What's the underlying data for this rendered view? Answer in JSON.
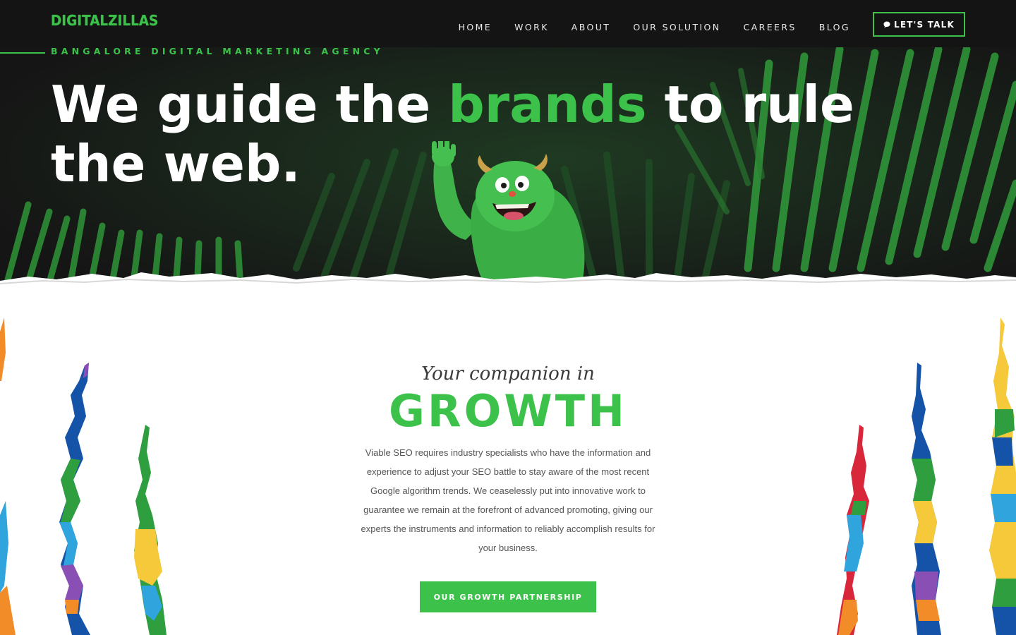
{
  "brand": {
    "logo_text": "DIGITALZILLAS",
    "accent_color": "#3cc24a",
    "dark_color": "#161616"
  },
  "nav": {
    "items": [
      {
        "label": "HOME"
      },
      {
        "label": "WORK"
      },
      {
        "label": "ABOUT"
      },
      {
        "label": "OUR SOLUTION"
      },
      {
        "label": "CAREERS"
      },
      {
        "label": "BLOG"
      }
    ],
    "cta_label": "LET'S TALK",
    "cta_icon": "chat-bubble-icon"
  },
  "hero": {
    "tagline": "BANGALORE DIGITAL MARKETING AGENCY",
    "headline_part1": "We guide the ",
    "headline_accent": "brands",
    "headline_part2": " to rule the web.",
    "mascot": "green-monster-mascot-waving",
    "background": "jungle-palm-leaves"
  },
  "growth": {
    "intro": "Your companion in",
    "title": "GROWTH",
    "body": "Viable SEO requires industry specialists who have the information and experience to adjust your SEO battle to stay aware of the most recent Google algorithm trends. We ceaselessly put into innovative work to guarantee we remain at the forefront of advanced promoting, giving our experts the instruments and information to reliably accomplish results for your business.",
    "button_label": "OUR GROWTH PARTNERSHIP",
    "decoration": "colorful-paint-streaks"
  }
}
